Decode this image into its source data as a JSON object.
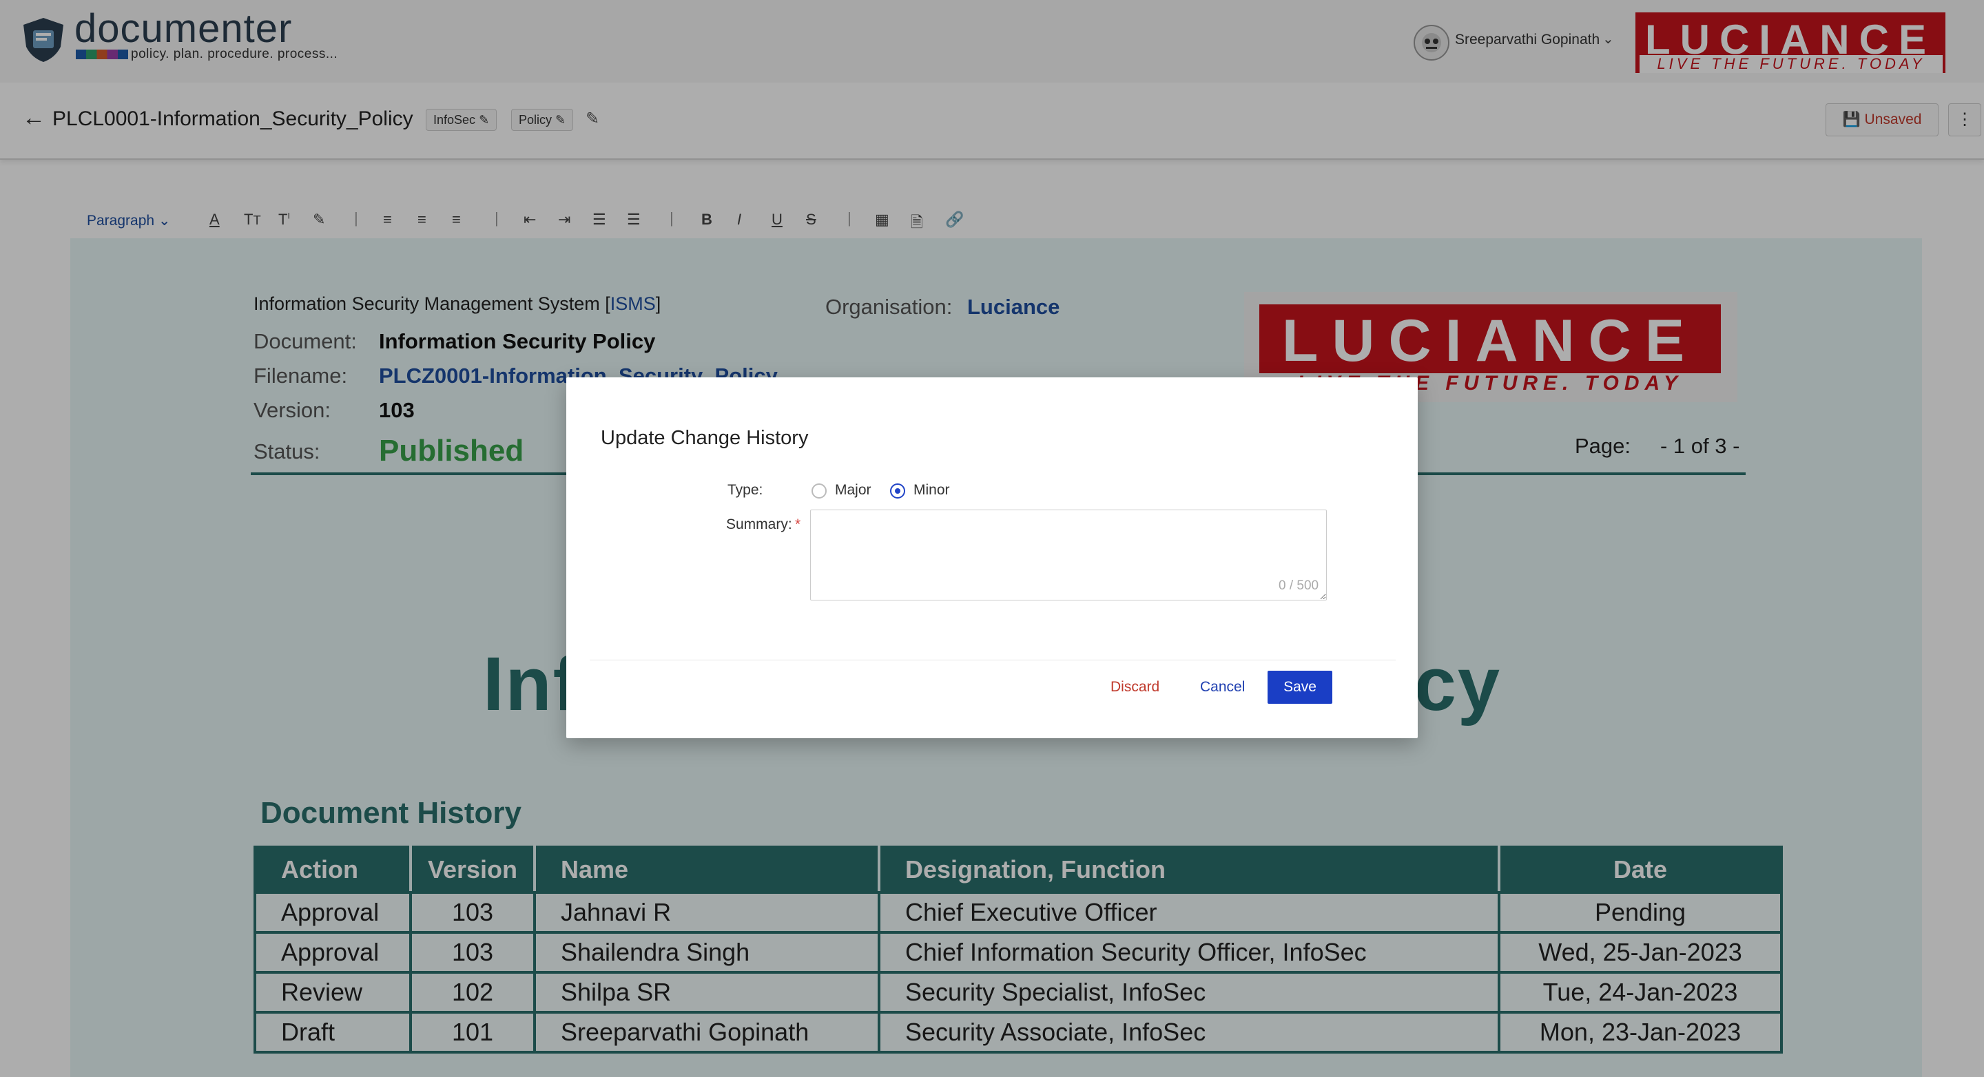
{
  "app": {
    "brand_name": "documenter",
    "brand_tagline": "policy. plan. procedure. process...",
    "user_name": "Sreeparvathi Gopinath",
    "company_logo_text": "LUCIANCE",
    "company_logo_tagline": "LIVE THE FUTURE. TODAY"
  },
  "titlebar": {
    "title": "PLCL0001-Information_Security_Policy",
    "chips": [
      "InfoSec",
      "Policy"
    ],
    "unsaved_label": "Unsaved",
    "kebab_label": "⋮"
  },
  "toolbar": {
    "paragraph_label": "Paragraph"
  },
  "document": {
    "isms_prefix": "Information Security Management System [",
    "isms_link": "ISMS",
    "isms_suffix": "]",
    "org_label": "Organisation:",
    "org_value": "Luciance",
    "doc_label": "Document:",
    "doc_value": "Information Security Policy",
    "filename_label": "Filename:",
    "filename_value": "PLCZ0001-Information_Security_Policy",
    "version_label": "Version:",
    "version_value": "103",
    "status_label": "Status:",
    "status_value": "Published",
    "page_label": "Page:",
    "page_value": "- 1 of 3 -",
    "big_title": "Information Security Policy",
    "logo_text": "LUCIANCE",
    "logo_tagline": "LIVE THE FUTURE. TODAY"
  },
  "history": {
    "title": "Document History",
    "headers": [
      "Action",
      "Version",
      "Name",
      "Designation, Function",
      "Date"
    ],
    "rows": [
      [
        "Approval",
        "103",
        "Jahnavi R",
        "Chief Executive Officer",
        "Pending"
      ],
      [
        "Approval",
        "103",
        "Shailendra Singh",
        "Chief Information Security Officer, InfoSec",
        "Wed, 25-Jan-2023"
      ],
      [
        "Review",
        "102",
        "Shilpa SR",
        "Security Specialist, InfoSec",
        "Tue, 24-Jan-2023"
      ],
      [
        "Draft",
        "101",
        "Sreeparvathi Gopinath",
        "Security Associate, InfoSec",
        "Mon, 23-Jan-2023"
      ]
    ]
  },
  "modal": {
    "title": "Update Change History",
    "type_label": "Type:",
    "major_label": "Major",
    "minor_label": "Minor",
    "selected_type": "Minor",
    "summary_label": "Summary:",
    "required_mark": "*",
    "summary_value": "",
    "char_count": "0 / 500",
    "discard_label": "Discard",
    "cancel_label": "Cancel",
    "save_label": "Save"
  },
  "colors": {
    "accent_blue": "#1a3ec5",
    "doc_teal": "#2a6f6c",
    "published_green": "#38a14a",
    "danger_red": "#c0392b",
    "brand_red": "#c8141c"
  }
}
